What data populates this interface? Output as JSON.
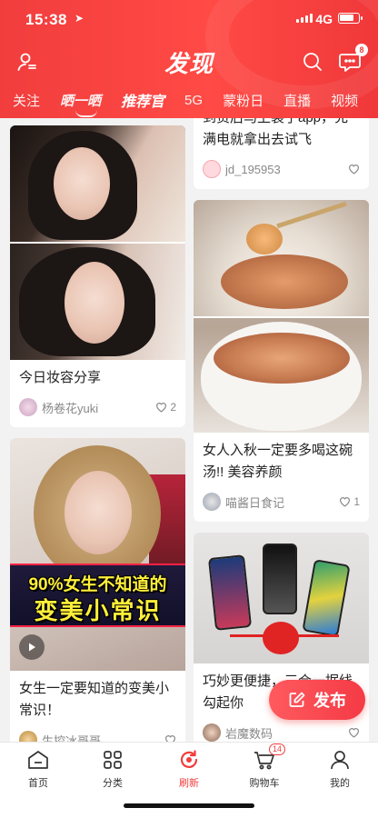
{
  "status_bar": {
    "time": "15:38",
    "network": "4G"
  },
  "header": {
    "title": "发现",
    "message_badge": "8",
    "tabs": [
      "关注",
      "晒一晒",
      "推荐官",
      "5G",
      "蒙粉日",
      "直播",
      "视频"
    ],
    "active_tab": "推荐官"
  },
  "feed": {
    "left": [
      {
        "title": "今日妆容分享",
        "author": "杨卷花yuki",
        "likes": "2"
      },
      {
        "overlay_line1": "90%女生不知道的",
        "overlay_line2": "变美小常识",
        "title": "女生一定要知道的变美小常识！",
        "author": "生控冰哥哥",
        "likes": ""
      }
    ],
    "right": [
      {
        "title": "到货后马上装了app，充满电就拿出去试飞",
        "author": "jd_195953",
        "likes": ""
      },
      {
        "title": "女人入秋一定要多喝这碗汤!! 美容养颜",
        "author": "喵酱日食记",
        "likes": "1"
      },
      {
        "title": "巧妙更便捷，三合一据线勾起你",
        "author": "岩魔数码",
        "likes": ""
      }
    ]
  },
  "fab": {
    "label": "发布"
  },
  "bottom_nav": {
    "items": [
      {
        "label": "首页",
        "icon": "home-icon"
      },
      {
        "label": "分类",
        "icon": "category-icon"
      },
      {
        "label": "刷新",
        "icon": "refresh-icon"
      },
      {
        "label": "购物车",
        "icon": "cart-icon",
        "badge": "14"
      },
      {
        "label": "我的",
        "icon": "profile-icon"
      }
    ],
    "active": "刷新"
  },
  "colors": {
    "brand_red": "#f13d3d"
  }
}
